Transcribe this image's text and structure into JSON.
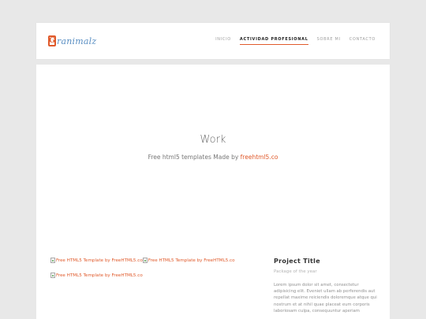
{
  "header": {
    "logo_letter": "G",
    "logo_text": "ranimalz",
    "nav": [
      {
        "label": "INICIO",
        "active": false
      },
      {
        "label": "ACTIVIDAD PROFESIONAL",
        "active": true
      },
      {
        "label": "SOBRE MI",
        "active": false
      },
      {
        "label": "CONTACTO",
        "active": false
      }
    ]
  },
  "hero": {
    "title": "Work",
    "subtitle_prefix": "Free html5 templates Made by ",
    "subtitle_link": "freehtml5.co"
  },
  "gallery": {
    "images_alt": [
      "Free HTML5 Template by FreeHTML5.co",
      "Free HTML5 Template by FreeHTML5.co",
      "Free HTML5 Template by FreeHTML5.co"
    ]
  },
  "project": {
    "title": "Project Title",
    "subtitle": "Package of the year",
    "description": "Lorem ipsum dolor sit amet, consectetur adipisicing elit. Eveniet ullam ab perferendis aut repellat maxime reiciendis doloremque atque qui nostrum et at nihil quae placeat eum corporis laboriosam culpa, consequuntur aperiam"
  },
  "colors": {
    "accent": "#e05a2b",
    "logo_text": "#5a8fc3",
    "background": "#e8e8e8"
  }
}
